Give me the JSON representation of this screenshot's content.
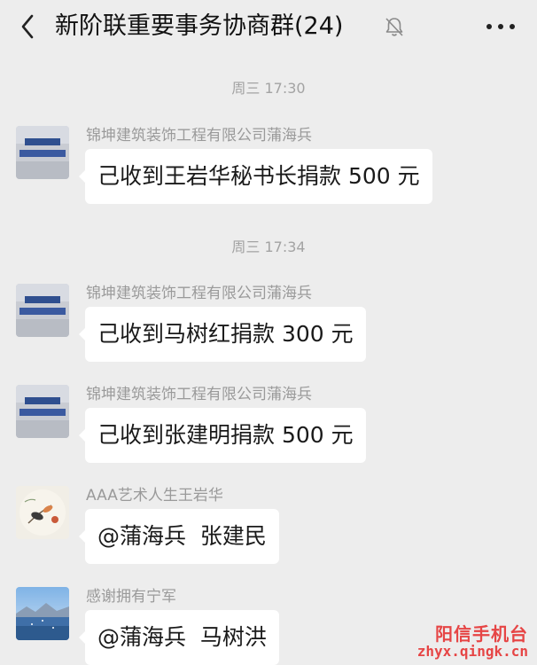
{
  "header": {
    "title": "新阶联重要事务协商群(24)",
    "back_icon": "chevron-left-icon",
    "mute_icon": "bell-muted-icon",
    "more_icon": "more-dots-icon"
  },
  "timestamps": [
    "周三 17:30",
    "周三 17:34"
  ],
  "messages": [
    {
      "sender": "锦坤建筑装饰工程有限公司蒲海兵",
      "text": "己收到王岩华秘书长捐款 500 元",
      "avatar": "company-logo-avatar"
    },
    {
      "sender": "锦坤建筑装饰工程有限公司蒲海兵",
      "text": "己收到马树红捐款 300 元",
      "avatar": "company-logo-avatar"
    },
    {
      "sender": "锦坤建筑装饰工程有限公司蒲海兵",
      "text": "己收到张建明捐款 500 元",
      "avatar": "company-logo-avatar"
    },
    {
      "sender": "AAA艺术人生王岩华",
      "text": "@蒲海兵  张建民",
      "avatar": "bird-painting-avatar"
    },
    {
      "sender": "感谢拥有宁军",
      "text": "@蒲海兵  马树洪",
      "avatar": "lake-mountain-avatar"
    }
  ],
  "watermark": {
    "line1": "阳信手机台",
    "line2": "zhyx.qingk.cn"
  },
  "colors": {
    "background": "#ededed",
    "bubble": "#ffffff",
    "sender_text": "#9a9a9a",
    "timestamp_text": "#a3a3a3",
    "watermark": "#e64545"
  }
}
